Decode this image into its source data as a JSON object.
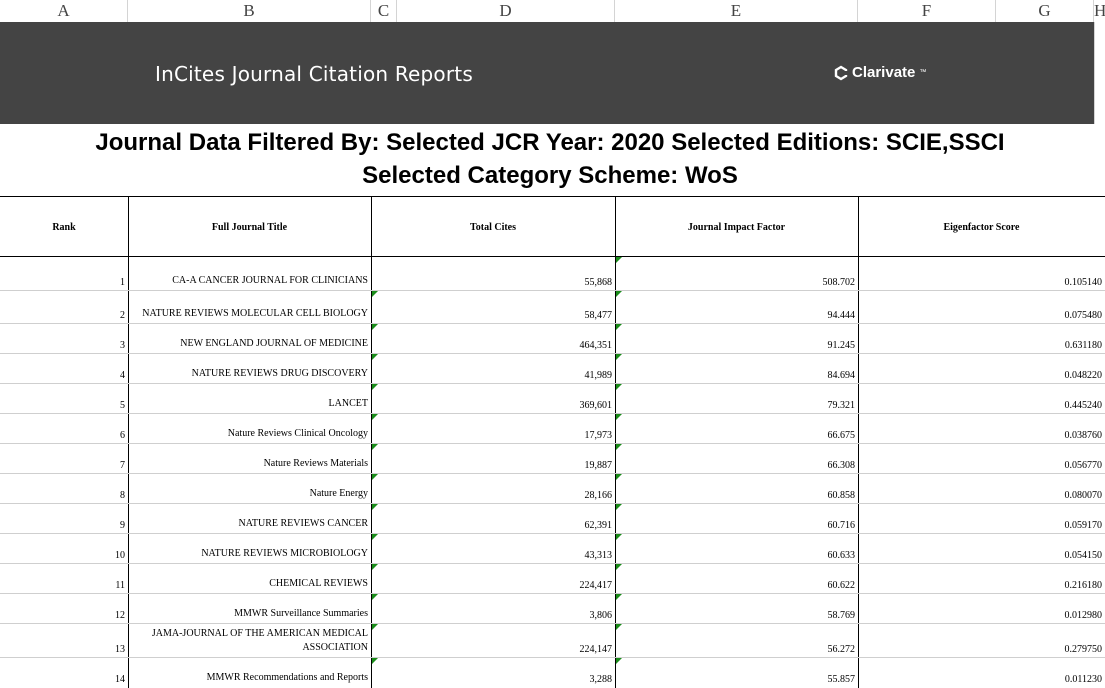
{
  "column_letters": [
    "A",
    "B",
    "C",
    "D",
    "E",
    "F",
    "G",
    "H"
  ],
  "banner": {
    "app_title": "InCites Journal Citation Reports",
    "brand": "Clarivate",
    "brand_mark": "™"
  },
  "filter_title": {
    "line1": "Journal Data Filtered By:  Selected JCR Year: 2020 Selected Editions: SCIE,SSCI",
    "line2": "Selected Category Scheme: WoS"
  },
  "table": {
    "headers": [
      "Rank",
      "Full Journal Title",
      "Total Cites",
      "Journal Impact Factor",
      "Eigenfactor Score"
    ],
    "rows": [
      {
        "rank": "1",
        "title": "CA-A CANCER JOURNAL FOR CLINICIANS",
        "cites": "55,868",
        "jif": "508.702",
        "eigen": "0.105140"
      },
      {
        "rank": "2",
        "title": "NATURE REVIEWS MOLECULAR CELL BIOLOGY",
        "cites": "58,477",
        "jif": "94.444",
        "eigen": "0.075480"
      },
      {
        "rank": "3",
        "title": "NEW ENGLAND JOURNAL OF MEDICINE",
        "cites": "464,351",
        "jif": "91.245",
        "eigen": "0.631180"
      },
      {
        "rank": "4",
        "title": "NATURE REVIEWS DRUG DISCOVERY",
        "cites": "41,989",
        "jif": "84.694",
        "eigen": "0.048220"
      },
      {
        "rank": "5",
        "title": "LANCET",
        "cites": "369,601",
        "jif": "79.321",
        "eigen": "0.445240"
      },
      {
        "rank": "6",
        "title": "Nature Reviews Clinical Oncology",
        "cites": "17,973",
        "jif": "66.675",
        "eigen": "0.038760"
      },
      {
        "rank": "7",
        "title": "Nature Reviews Materials",
        "cites": "19,887",
        "jif": "66.308",
        "eigen": "0.056770"
      },
      {
        "rank": "8",
        "title": "Nature Energy",
        "cites": "28,166",
        "jif": "60.858",
        "eigen": "0.080070"
      },
      {
        "rank": "9",
        "title": "NATURE REVIEWS CANCER",
        "cites": "62,391",
        "jif": "60.716",
        "eigen": "0.059170"
      },
      {
        "rank": "10",
        "title": "NATURE REVIEWS MICROBIOLOGY",
        "cites": "43,313",
        "jif": "60.633",
        "eigen": "0.054150"
      },
      {
        "rank": "11",
        "title": "CHEMICAL REVIEWS",
        "cites": "224,417",
        "jif": "60.622",
        "eigen": "0.216180"
      },
      {
        "rank": "12",
        "title": "MMWR Surveillance Summaries",
        "cites": "3,806",
        "jif": "58.769",
        "eigen": "0.012980"
      },
      {
        "rank": "13",
        "title": "JAMA-JOURNAL OF THE AMERICAN MEDICAL ASSOCIATION",
        "cites": "224,147",
        "jif": "56.272",
        "eigen": "0.279750"
      },
      {
        "rank": "14",
        "title": "MMWR Recommendations and Reports",
        "cites": "3,288",
        "jif": "55.857",
        "eigen": "0.011230"
      }
    ]
  }
}
